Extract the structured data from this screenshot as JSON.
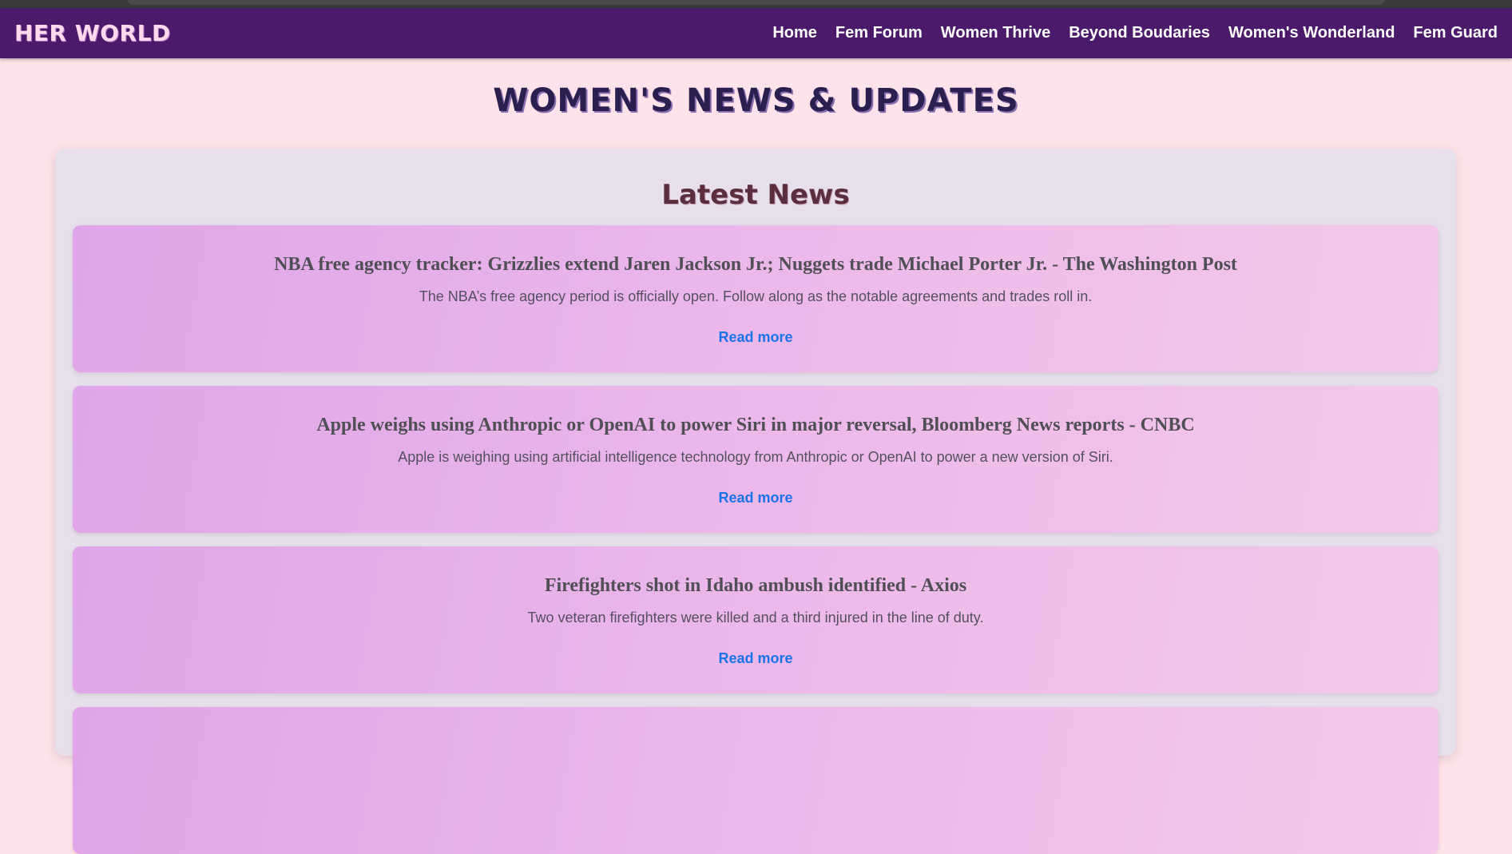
{
  "navbar": {
    "logo": "HER WORLD",
    "links": [
      {
        "label": "Home"
      },
      {
        "label": "Fem Forum"
      },
      {
        "label": "Women Thrive"
      },
      {
        "label": "Beyond Boudaries"
      },
      {
        "label": "Women's Wonderland"
      },
      {
        "label": "Fem Guard"
      }
    ]
  },
  "page": {
    "title": "WOMEN'S NEWS & UPDATES"
  },
  "news": {
    "section_title": "Latest News",
    "read_more_label": "Read more",
    "articles": [
      {
        "title": "NBA free agency tracker: Grizzlies extend Jaren Jackson Jr.; Nuggets trade Michael Porter Jr. - The Washington Post",
        "description": "The NBA’s free agency period is officially open. Follow along as the notable agreements and trades roll in."
      },
      {
        "title": "Apple weighs using Anthropic or OpenAI to power Siri in major reversal, Bloomberg News reports - CNBC",
        "description": "Apple is weighing using artificial intelligence technology from Anthropic or OpenAI to power a new version of Siri."
      },
      {
        "title": "Firefighters shot in Idaho ambush identified - Axios",
        "description": "Two veteran firefighters were killed and a third injured in the line of duty."
      },
      {
        "title": "",
        "description": ""
      }
    ]
  },
  "colors": {
    "navbar_bg": "#4b1a6b",
    "page_bg": "#ffe3ea",
    "panel_bg": "#e7dfeb",
    "link": "#1a73e8"
  }
}
